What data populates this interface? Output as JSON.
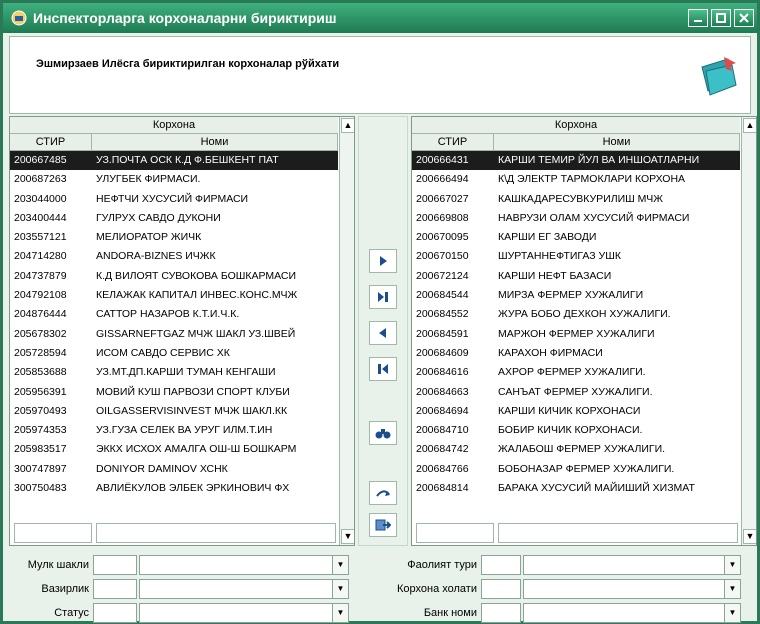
{
  "window": {
    "title": "Инспекторларга корхоналарни бириктириш"
  },
  "header": {
    "text": "Эшмирзаев Илёсга бириктирилган корхоналар рўйхати"
  },
  "left_grid": {
    "group_header": "Корхона",
    "col_stir": "СТИР",
    "col_name": "Номи",
    "rows": [
      [
        "200667485",
        "УЗ.ПОЧТА ОСК К.Д Ф.БЕШКЕНТ ПАТ"
      ],
      [
        "200687263",
        "УЛУГБЕК ФИРМАСИ."
      ],
      [
        "203044000",
        "НЕФТЧИ ХУСУСИЙ ФИРМАСИ"
      ],
      [
        "203400444",
        "ГУЛРУХ САВДО ДУКОНИ"
      ],
      [
        "203557121",
        "МЕЛИОРАТОР ЖИЧК"
      ],
      [
        "204714280",
        "ANDORA-BIZNES ИЧЖК"
      ],
      [
        "204737879",
        "К.Д ВИЛОЯТ СУВОКОВА БОШКАРМАСИ"
      ],
      [
        "204792108",
        "КЕЛАЖАК КАПИТАЛ ИНВЕС.КОНС.МЧЖ"
      ],
      [
        "204876444",
        "САТТОР НАЗАРОВ К.Т.И.Ч.К."
      ],
      [
        "205678302",
        "GISSARNEFTGAZ МЧЖ ШАКЛ УЗ.ШВЕЙ"
      ],
      [
        "205728594",
        "ИСОМ САВДО СЕРВИС ХК"
      ],
      [
        "205853688",
        "УЗ.МТ.ДП.КАРШИ ТУМАН КЕНГАШИ"
      ],
      [
        "205956391",
        "МОВИЙ КУШ ПАРВОЗИ СПОРТ КЛУБИ"
      ],
      [
        "205970493",
        "OILGASSERVISINVEST МЧЖ ШАКЛ.КК"
      ],
      [
        "205974353",
        "УЗ.ГУЗА СЕЛЕК ВА УРУГ ИЛМ.Т.ИН"
      ],
      [
        "205983517",
        "ЭККХ ИСХОХ АМАЛГА ОШ-Ш БОШКАРМ"
      ],
      [
        "300747897",
        "DONIYOR DAMINOV ХСНК"
      ],
      [
        "300750483",
        "АВЛИЁКУЛОВ ЭЛБЕК ЭРКИНОВИЧ ФХ"
      ]
    ]
  },
  "right_grid": {
    "group_header": "Корхона",
    "col_stir": "СТИР",
    "col_name": "Номи",
    "rows": [
      [
        "200666431",
        "КАРШИ ТЕМИР ЙУЛ ВА ИНШОАТЛАРНИ"
      ],
      [
        "200666494",
        "К\\Д ЭЛЕКТР ТАРМОКЛАРИ КОРХОНА"
      ],
      [
        "200667027",
        "КАШКАДАРЕСУВКУРИЛИШ МЧЖ"
      ],
      [
        "200669808",
        "НАВРУЗИ ОЛАМ ХУСУСИЙ ФИРМАСИ"
      ],
      [
        "200670095",
        "КАРШИ ЕГ ЗАВОДИ"
      ],
      [
        "200670150",
        "ШУРТАННЕФТИГАЗ УШК"
      ],
      [
        "200672124",
        "КАРШИ НЕФТ БАЗАСИ"
      ],
      [
        "200684544",
        "МИРЗА ФЕРМЕР ХУЖАЛИГИ"
      ],
      [
        "200684552",
        "ЖУРА БОБО ДЕХКОН ХУЖАЛИГИ."
      ],
      [
        "200684591",
        "МАРЖОН ФЕРМЕР ХУЖАЛИГИ"
      ],
      [
        "200684609",
        "КАРАХОН ФИРМАСИ"
      ],
      [
        "200684616",
        "АХРОР ФЕРМЕР ХУЖАЛИГИ."
      ],
      [
        "200684663",
        "САНЪАТ ФЕРМЕР ХУЖАЛИГИ."
      ],
      [
        "200684694",
        "КАРШИ КИЧИК КОРХОНАСИ"
      ],
      [
        "200684710",
        "БОБИР КИЧИК КОРХОНАСИ."
      ],
      [
        "200684742",
        "ЖАЛАБОШ ФЕРМЕР ХУЖАЛИГИ."
      ],
      [
        "200684766",
        "БОБОНАЗАР ФЕРМЕР ХУЖАЛИГИ."
      ],
      [
        "200684814",
        "БАРАКА ХУСУСИЙ МАЙИШИЙ ХИЗМАТ"
      ]
    ]
  },
  "filters": {
    "mulk_shakli": "Мулк шакли",
    "vazirlik": "Вазирлик",
    "status": "Статус",
    "faoliyat_turi": "Фаолият тури",
    "korxona_holati": "Корхона холати",
    "bank_nomi": "Банк номи"
  },
  "colors": {
    "title_bar": "#2b8f63",
    "selected_row": "#1c1c1c",
    "accent": "#2b7a57"
  }
}
